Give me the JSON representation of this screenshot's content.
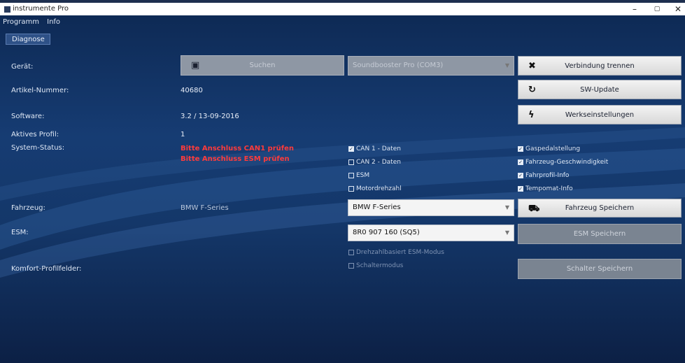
{
  "window": {
    "title": "instrumente Pro",
    "min": "–",
    "max": "▢",
    "close": "✕"
  },
  "menu": [
    "Programm",
    "Info"
  ],
  "tab": "Diagnose",
  "labels": {
    "geraet": "Gerät:",
    "artikel": "Artikel-Nummer:",
    "software": "Software:",
    "profil": "Aktives Profil:",
    "status": "System-Status:",
    "fahrzeug": "Fahrzeug:",
    "esm": "ESM:",
    "komfort": "Komfort-Profilfelder:"
  },
  "values": {
    "artikel": "40680",
    "software": "3.2 / 13-09-2016",
    "profil": "1",
    "fahrzeug": "BMW F-Series"
  },
  "errors": [
    "Bitte Anschluss CAN1 prüfen",
    "Bitte Anschluss ESM prüfen"
  ],
  "buttons": {
    "suchen": "Suchen",
    "trennen": "Verbindung trennen",
    "update": "SW-Update",
    "werks": "Werkseinstellungen",
    "fz_speichern": "Fahrzeug Speichern",
    "esm_speichern": "ESM Speichern",
    "sch_speichern": "Schalter Speichern"
  },
  "selects": {
    "device": "Soundbooster Pro (COM3)",
    "fahrzeug": "BMW F-Series",
    "esm": "8R0 907 160 (SQ5)"
  },
  "checks_mid": [
    {
      "label": "CAN 1 - Daten",
      "checked": true
    },
    {
      "label": "CAN 2 - Daten",
      "checked": false
    },
    {
      "label": "ESM",
      "checked": false
    },
    {
      "label": "Motordrehzahl",
      "checked": false
    }
  ],
  "checks_right": [
    {
      "label": "Gaspedalstellung",
      "checked": true
    },
    {
      "label": "Fahrzeug-Geschwindigkeit",
      "checked": true
    },
    {
      "label": "Fahrprofil-Info",
      "checked": true
    },
    {
      "label": "Tempomat-Info",
      "checked": true
    }
  ],
  "checks_esm": [
    {
      "label": "Drehzahlbasiert ESM-Modus",
      "checked": false
    },
    {
      "label": "Schaltermodus",
      "checked": false
    }
  ],
  "colors": {
    "error": "#ff3b3b",
    "bg": "#163c73"
  }
}
